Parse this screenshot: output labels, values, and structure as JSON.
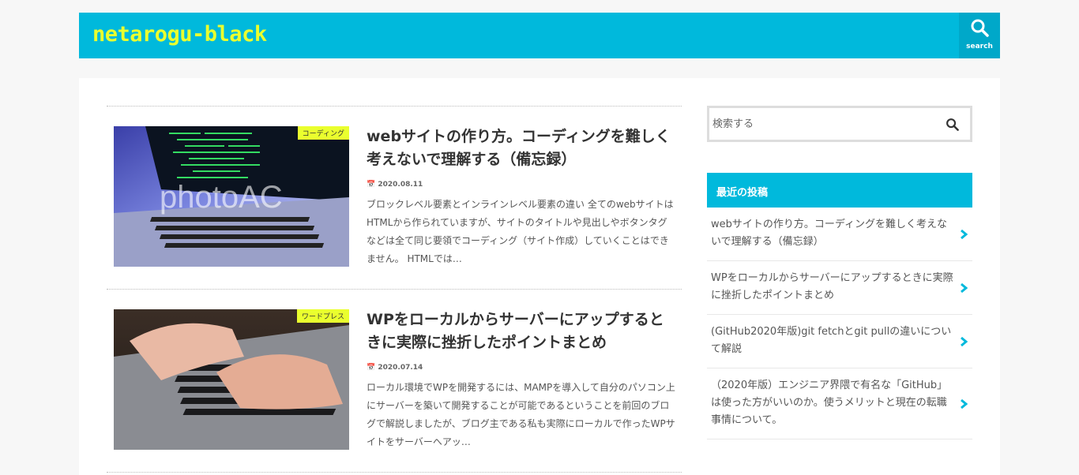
{
  "header": {
    "logo": "netarogu-black",
    "search_label": "search"
  },
  "articles": [
    {
      "category": "コーディング",
      "title": "webサイトの作り方。コーディングを難しく考えないで理解する（備忘録）",
      "date": "2020.08.11",
      "excerpt": "ブロックレベル要素とインラインレベル要素の違い 全てのwebサイトはHTMLから作られていますが、サイトのタイトルや見出しやボタンタグなどは全て同じ要領でコーディング（サイト作成）していくことはできません。 HTMLでは…",
      "watermark": "photoAC"
    },
    {
      "category": "ワードプレス",
      "title": "WPをローカルからサーバーにアップするときに実際に挫折したポイントまとめ",
      "date": "2020.07.14",
      "excerpt": "ローカル環境でWPを開発するには、MAMPを導入して自分のパソコン上にサーバーを築いて開発することが可能であるということを前回のブログで解説しましたが、ブログ主である私も実際にローカルで作ったWPサイトをサーバーへアッ…"
    }
  ],
  "sidebar": {
    "search_placeholder": "検索する",
    "recent_title": "最近の投稿",
    "recent_posts": [
      "webサイトの作り方。コーディングを難しく考えないで理解する（備忘録）",
      "WPをローカルからサーバーにアップするときに実際に挫折したポイントまとめ",
      "(GitHub2020年版)git fetchとgit pullの違いについて解説",
      "（2020年版）エンジニア界隈で有名な「GitHub」は使った方がいいのか。使うメリットと現在の転職事情について。"
    ]
  },
  "colors": {
    "accent": "#00b9dc",
    "logo": "#eaff2e",
    "category_badge": "#eaff2e"
  },
  "icons": {
    "header_search": "search-icon",
    "sidebar_search": "search-icon",
    "post_arrow": "chevron-right-icon"
  }
}
